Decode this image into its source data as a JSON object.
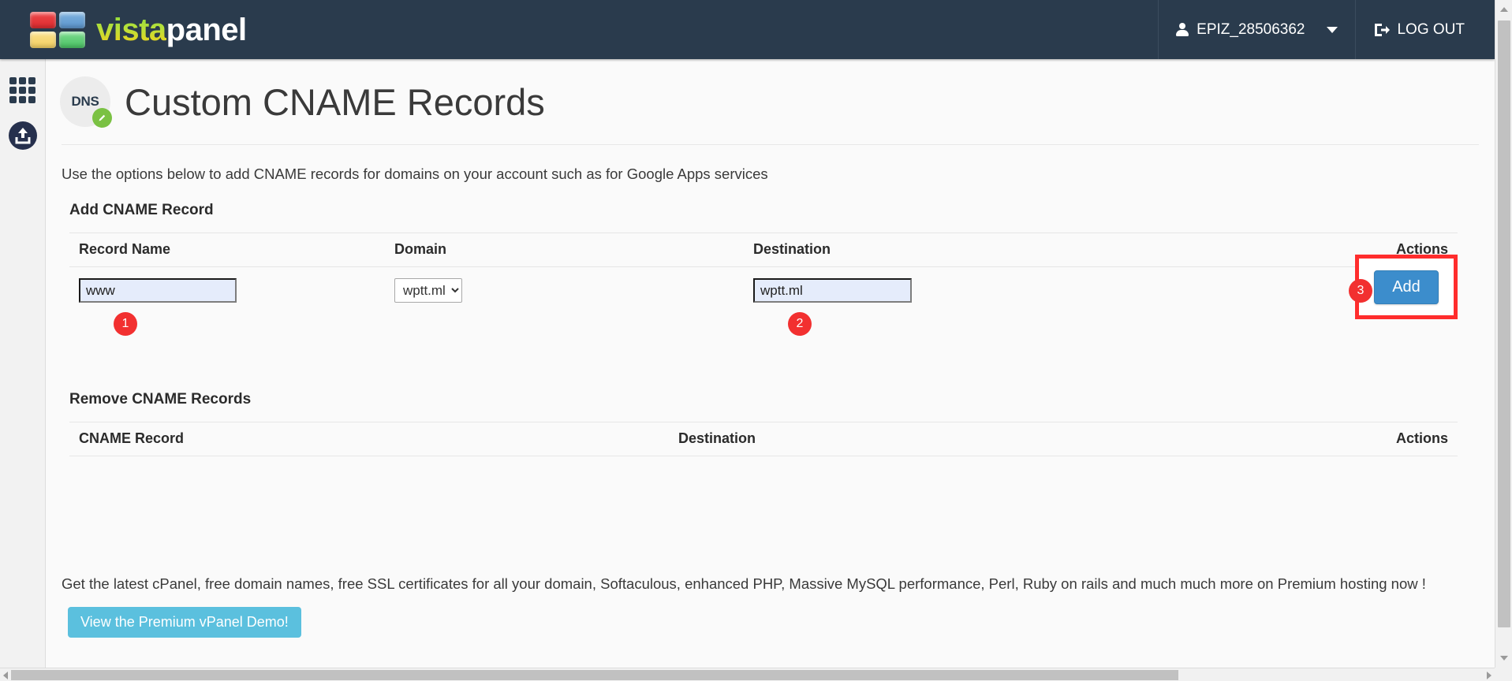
{
  "navbar": {
    "brand_vista": "vista",
    "brand_panel": "panel",
    "username": "EPIZ_28506362",
    "logout_label": "LOG OUT"
  },
  "sidebar": {
    "items": [
      {
        "icon": "apps-grid-icon",
        "label": ""
      },
      {
        "icon": "upload-icon",
        "label": ""
      }
    ]
  },
  "page": {
    "badge_text": "DNS",
    "title": "Custom CNAME Records",
    "intro": "Use the options below to add CNAME records for domains on your account such as for Google Apps services"
  },
  "add_section": {
    "heading": "Add CNAME Record",
    "columns": [
      "Record Name",
      "Domain",
      "Destination",
      "Actions"
    ],
    "record_name_value": "www",
    "record_name_placeholder": "",
    "domain_selected": "wptt.ml",
    "domain_options": [
      "wptt.ml"
    ],
    "destination_value": "wptt.ml",
    "destination_placeholder": "",
    "add_button_label": "Add"
  },
  "remove_section": {
    "heading": "Remove CNAME Records",
    "columns": [
      "CNAME Record",
      "Destination",
      "Actions"
    ],
    "rows": []
  },
  "annotations": [
    {
      "number": "1",
      "target": "record-name-input"
    },
    {
      "number": "2",
      "target": "destination-input"
    },
    {
      "number": "3",
      "target": "add-button"
    }
  ],
  "promo": {
    "text": "Get the latest cPanel, free domain names, free SSL certificates for all your domain, Softaculous, enhanced PHP, Massive MySQL performance, Perl, Ruby on rails and much much more on Premium hosting now !",
    "button_label": "View the Premium vPanel Demo!"
  },
  "colors": {
    "navbar_bg": "#2a3b4d",
    "accent_blue": "#3c8dcc",
    "promo_blue": "#5bc0de",
    "annotation_red": "#f23030",
    "badge_green": "#7ac143",
    "input_fill": "#e5ecfb"
  }
}
